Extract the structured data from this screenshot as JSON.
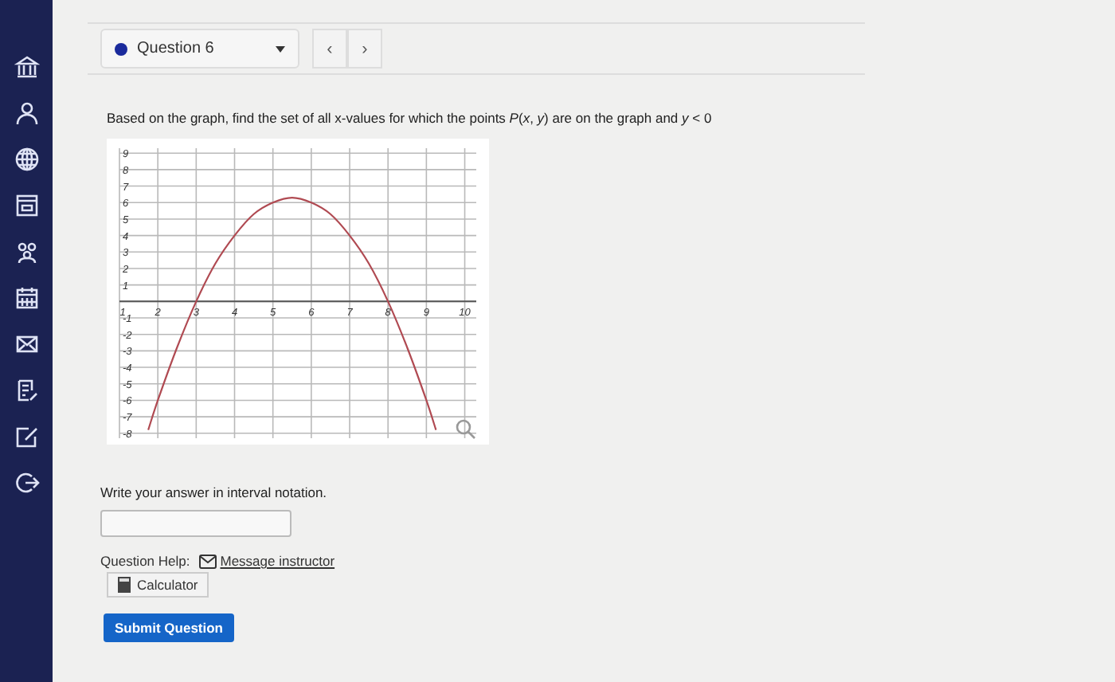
{
  "question_nav": {
    "label": "Question 6",
    "prev": "‹",
    "next": "›"
  },
  "question": {
    "text": "Based on the graph, find the set of all x-values for which  the points *P*(*x*, *y*) are on the graph and *y* < 0",
    "chart_data": {
      "type": "line",
      "grid": true,
      "xlim": [
        1,
        10
      ],
      "ylim": [
        -8,
        9
      ],
      "xticks": [
        1,
        2,
        3,
        4,
        5,
        6,
        7,
        8,
        9,
        10
      ],
      "yticks": [
        -8,
        -7,
        -6,
        -5,
        -4,
        -3,
        -2,
        -1,
        1,
        2,
        3,
        4,
        5,
        6,
        7,
        8,
        9
      ],
      "x": [
        1.75,
        2,
        2.5,
        3,
        3.5,
        4,
        4.5,
        5,
        5.5,
        6,
        6.5,
        7,
        7.5,
        8,
        8.5,
        9,
        9.25
      ],
      "series": [
        {
          "color": "#b04a52",
          "values": [
            -7.8,
            -6,
            -2.8,
            0,
            2.3,
            4,
            5.3,
            6,
            6.3,
            6,
            5.3,
            4,
            2.3,
            0,
            -2.8,
            -6,
            -7.8
          ]
        }
      ]
    }
  },
  "answer": {
    "prompt": "Write your answer in interval notation."
  },
  "help": {
    "label": "Question Help:",
    "link": "Message instructor",
    "calculator": "Calculator"
  },
  "submit": "Submit Question"
}
